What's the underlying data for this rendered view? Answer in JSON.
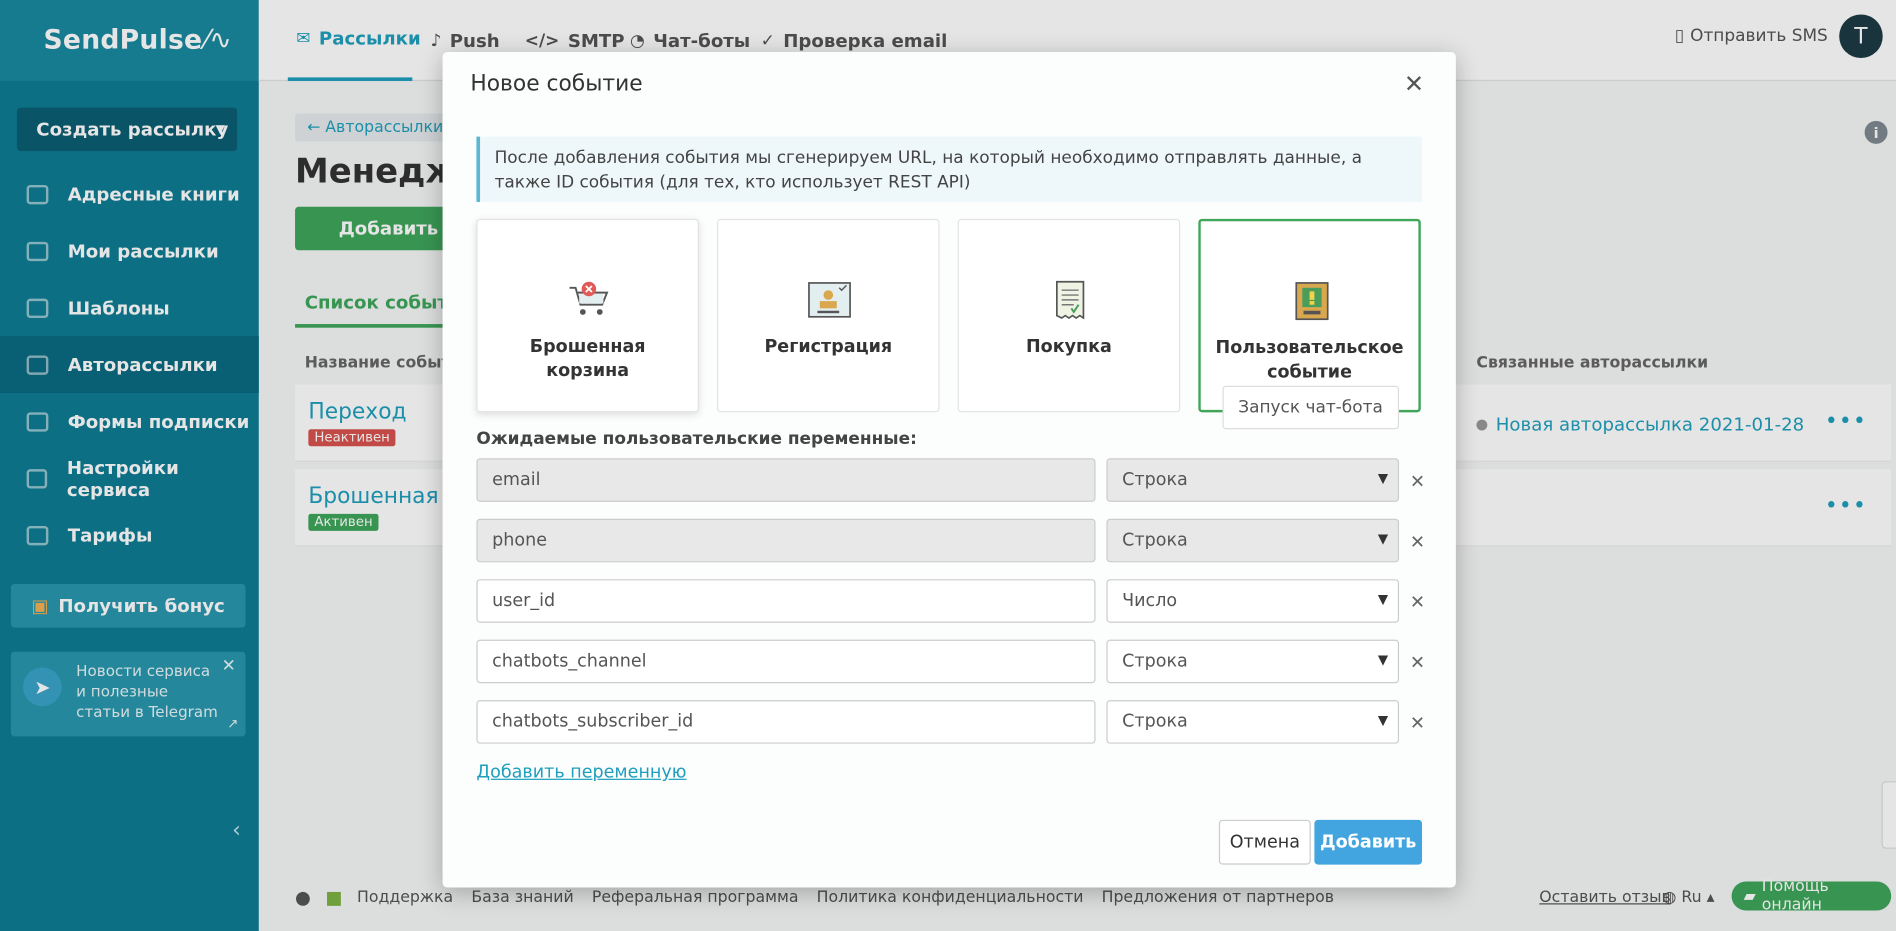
{
  "logo": {
    "text": "SendPulse",
    "mark": "⁄∿"
  },
  "sidebar": {
    "create_button": "Создать рассылку",
    "items": [
      {
        "label": "Адресные книги"
      },
      {
        "label": "Мои рассылки"
      },
      {
        "label": "Шаблоны"
      },
      {
        "label": "Авторассылки"
      },
      {
        "label": "Формы подписки"
      },
      {
        "label": "Настройки сервиса"
      },
      {
        "label": "Тарифы"
      }
    ],
    "bonus_button": "Получить бонус",
    "telegram_card": "Новости сервиса и полезные статьи в Telegram"
  },
  "topnav": {
    "items": [
      {
        "label": "Рассылки"
      },
      {
        "label": "Push"
      },
      {
        "label": "SMTP"
      },
      {
        "label": "Чат-боты"
      },
      {
        "label": "Проверка email"
      }
    ],
    "sms_label": "Отправить SMS",
    "avatar_letter": "T"
  },
  "main": {
    "back_link": "← Авторассылки",
    "page_title": "Менедже",
    "add_button": "Добавить но",
    "tab_label": "Список событий",
    "col_name": "Название события",
    "col_linked": "Связанные авторассылки",
    "rows": [
      {
        "name": "Переход",
        "status": "Неактивен",
        "linked": "Новая авторассылка 2021-01-28"
      },
      {
        "name": "Брошенная кор",
        "status": "Активен",
        "linked": ""
      }
    ]
  },
  "footer": {
    "links": [
      "Поддержка",
      "База знаний",
      "Реферальная программа",
      "Политика конфиденциальности",
      "Предложения от партнеров"
    ],
    "review": "Оставить отзыв",
    "lang": "Ru",
    "help": "Помощь онлайн"
  },
  "modal": {
    "title": "Новое событие",
    "info": "После добавления события мы сгенерируем URL, на который необходимо отправлять данные, а также ID события (для тех, кто использует REST API)",
    "types": [
      {
        "label": "Брошенная корзина",
        "icon": "cart-icon"
      },
      {
        "label": "Регистрация",
        "icon": "registration-icon"
      },
      {
        "label": "Покупка",
        "icon": "receipt-icon"
      },
      {
        "label": "Пользовательское событие",
        "icon": "custom-event-icon"
      }
    ],
    "tooltip": "Запуск чат-бота",
    "vars_label": "Ожидаемые пользовательские переменные:",
    "variables": [
      {
        "name": "email",
        "type": "Строка"
      },
      {
        "name": "phone",
        "type": "Строка"
      },
      {
        "name": "user_id",
        "type": "Число"
      },
      {
        "name": "chatbots_channel",
        "type": "Строка"
      },
      {
        "name": "chatbots_subscriber_id",
        "type": "Строка"
      }
    ],
    "add_variable": "Добавить переменную",
    "cancel": "Отмена",
    "submit": "Добавить"
  },
  "colors": {
    "sidebar": "#0f7c94",
    "accent": "#1f9fbd",
    "green": "#3fa65b",
    "primary_button": "#42a5e0"
  }
}
